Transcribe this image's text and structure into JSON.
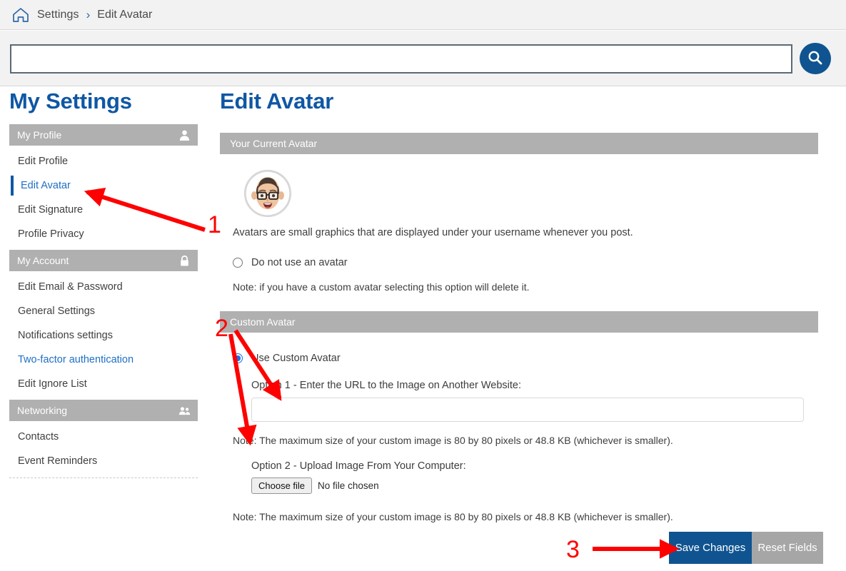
{
  "breadcrumb": {
    "home_icon": "home-icon",
    "items": [
      "Settings",
      "Edit Avatar"
    ],
    "separator": "›"
  },
  "search": {
    "value": "",
    "placeholder": "",
    "button_icon": "search-icon"
  },
  "sidebar": {
    "title": "My Settings",
    "groups": [
      {
        "label": "My Profile",
        "icon": "user-icon",
        "items": [
          {
            "label": "Edit Profile",
            "state": "normal"
          },
          {
            "label": "Edit Avatar",
            "state": "active"
          },
          {
            "label": "Edit Signature",
            "state": "normal"
          },
          {
            "label": "Profile Privacy",
            "state": "normal"
          }
        ]
      },
      {
        "label": "My Account",
        "icon": "lock-icon",
        "items": [
          {
            "label": "Edit Email & Password",
            "state": "normal"
          },
          {
            "label": "General Settings",
            "state": "normal"
          },
          {
            "label": "Notifications settings",
            "state": "normal"
          },
          {
            "label": "Two-factor authentication",
            "state": "link"
          },
          {
            "label": "Edit Ignore List",
            "state": "normal"
          }
        ]
      },
      {
        "label": "Networking",
        "icon": "people-icon",
        "items": [
          {
            "label": "Contacts",
            "state": "normal"
          },
          {
            "label": "Event Reminders",
            "state": "normal"
          }
        ]
      }
    ]
  },
  "main": {
    "title": "Edit Avatar",
    "current_section": {
      "heading": "Your Current Avatar",
      "avatar_alt": "memoji-avatar",
      "description": "Avatars are small graphics that are displayed under your username whenever you post.",
      "no_avatar_option": "Do not use an avatar",
      "no_avatar_note": "Note: if you have a custom avatar selecting this option will delete it."
    },
    "custom_section": {
      "heading": "Custom Avatar",
      "use_custom_option": "Use Custom Avatar",
      "option1_label": "Option 1 - Enter the URL to the Image on Another Website:",
      "option1_value": "",
      "option1_placeholder": "",
      "option1_note": "Note: The maximum size of your custom image is 80 by 80 pixels or 48.8 KB (whichever is smaller).",
      "option2_label": "Option 2 - Upload Image From Your Computer:",
      "file_button": "Choose file",
      "file_status": "No file chosen",
      "option2_note": "Note: The maximum size of your custom image is 80 by 80 pixels or 48.8 KB (whichever is smaller)."
    },
    "buttons": {
      "save": "Save Changes",
      "reset": "Reset Fields"
    }
  },
  "annotations": {
    "color": "#fe0000",
    "markers": [
      {
        "number": "1",
        "target": "sidebar-item-edit-avatar"
      },
      {
        "number": "2",
        "target": "custom-avatar-url-and-upload"
      },
      {
        "number": "3",
        "target": "save-changes-button"
      }
    ]
  },
  "colors": {
    "accent_blue": "#0f57a4",
    "button_blue": "#0f5490",
    "section_gray": "#b0b0b0",
    "button_gray": "#a6a6a6",
    "annotation_red": "#fe0000"
  }
}
